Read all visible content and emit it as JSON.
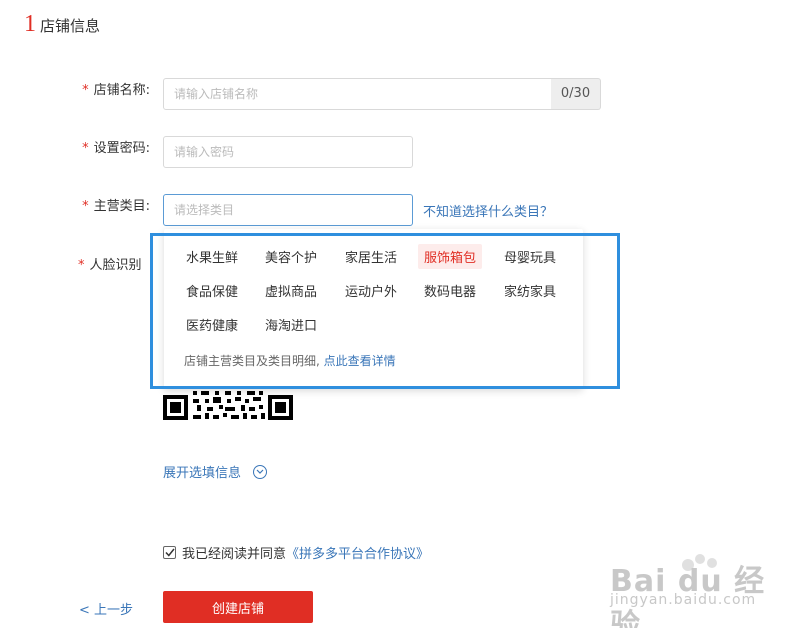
{
  "section": {
    "number": "1",
    "title": "店铺信息"
  },
  "form": {
    "required_mark": "*",
    "store_name": {
      "label": "店铺名称:",
      "placeholder": "请输入店铺名称",
      "counter": "0/30"
    },
    "password": {
      "label": "设置密码:",
      "placeholder": "请输入密码"
    },
    "category": {
      "label": "主营类目:",
      "placeholder": "请选择类目",
      "help_link": "不知道选择什么类目？"
    },
    "face_verify": {
      "label": "人脸识别"
    }
  },
  "category_dropdown": {
    "items": [
      "水果生鲜",
      "美容个护",
      "家居生活",
      "服饰箱包",
      "母婴玩具",
      "食品保健",
      "虚拟商品",
      "运动户外",
      "数码电器",
      "家纺家具",
      "医药健康",
      "海淘进口"
    ],
    "selected": "服饰箱包",
    "footer_text": "店铺主营类目及类目明细,",
    "footer_link": "点此查看详情"
  },
  "expand": {
    "label": "展开选填信息"
  },
  "agreement": {
    "text": "我已经阅读并同意",
    "link": "《拼多多平台合作协议》",
    "checked": true
  },
  "actions": {
    "prev": "< 上一步",
    "create": "创建店铺"
  },
  "watermark": {
    "brand": "Bai du 经验",
    "url": "jingyan.baidu.com"
  },
  "colors": {
    "accent": "#e02e24",
    "link": "#3a76b8",
    "highlight": "#2f8fde"
  }
}
